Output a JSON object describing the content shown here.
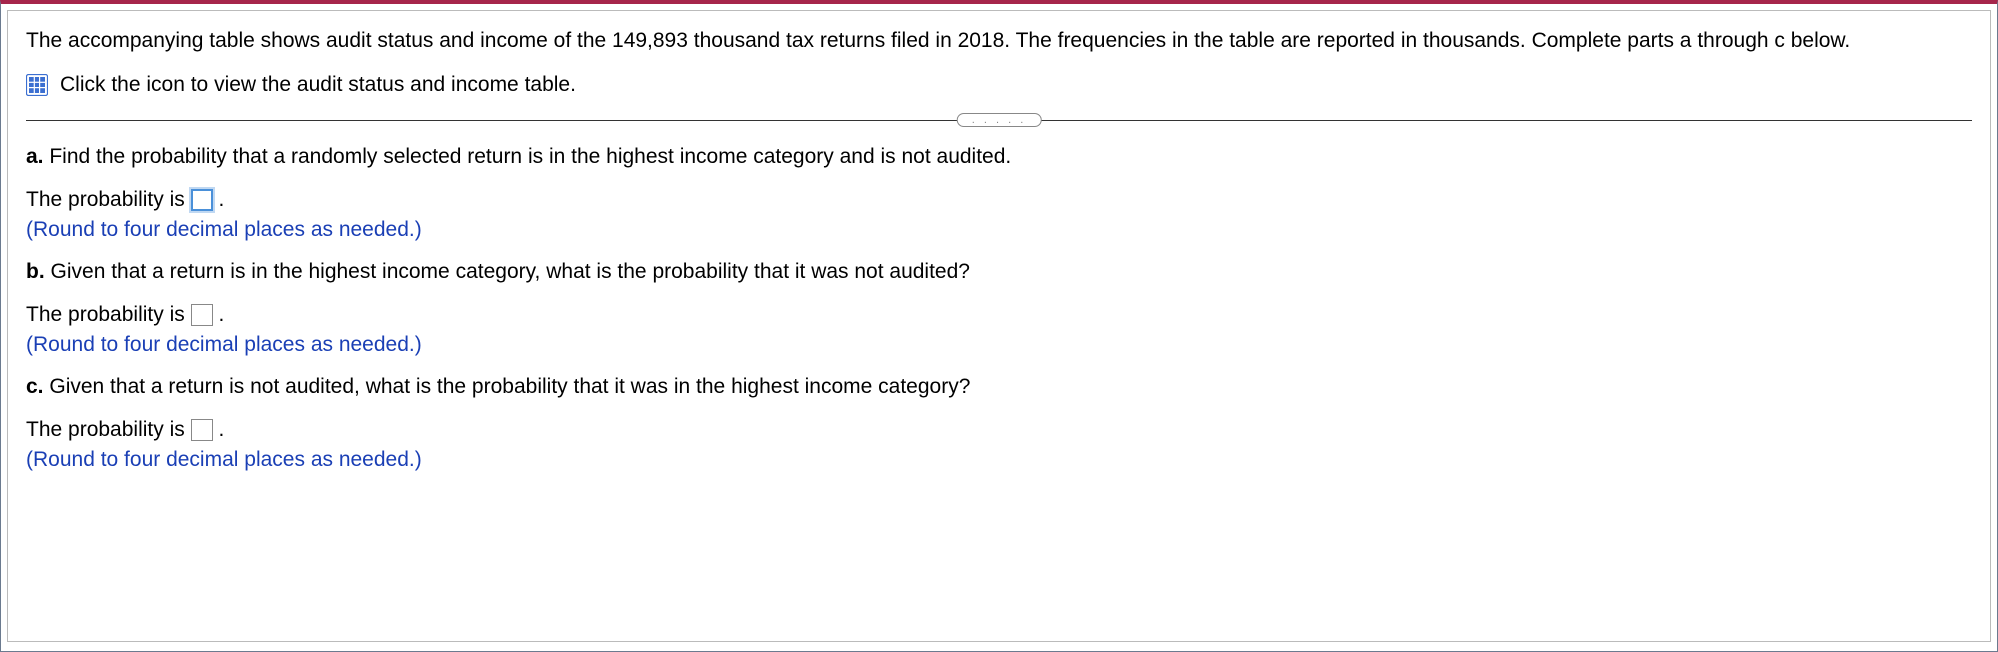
{
  "intro": "The accompanying table shows audit status and income of the 149,893 thousand tax returns filed in 2018. The frequencies in the table are reported in thousands. Complete parts a through c below.",
  "iconLinkText": "Click the icon to view the audit status and income table.",
  "separatorDots": ". . . . .",
  "parts": {
    "a": {
      "label": "a.",
      "question": "Find the probability that a randomly selected return is in the highest income category and is not audited.",
      "answerPrefix": "The probability is",
      "answerSuffix": ".",
      "hint": "(Round to four decimal places as needed.)"
    },
    "b": {
      "label": "b.",
      "question": "Given that a return is in the highest income category, what is the probability that it was not audited?",
      "answerPrefix": "The probability is",
      "answerSuffix": ".",
      "hint": "(Round to four decimal places as needed.)"
    },
    "c": {
      "label": "c.",
      "question": "Given that a return is not audited, what is the probability that it was in the highest income category?",
      "answerPrefix": "The probability is",
      "answerSuffix": ".",
      "hint": "(Round to four decimal places as needed.)"
    }
  }
}
